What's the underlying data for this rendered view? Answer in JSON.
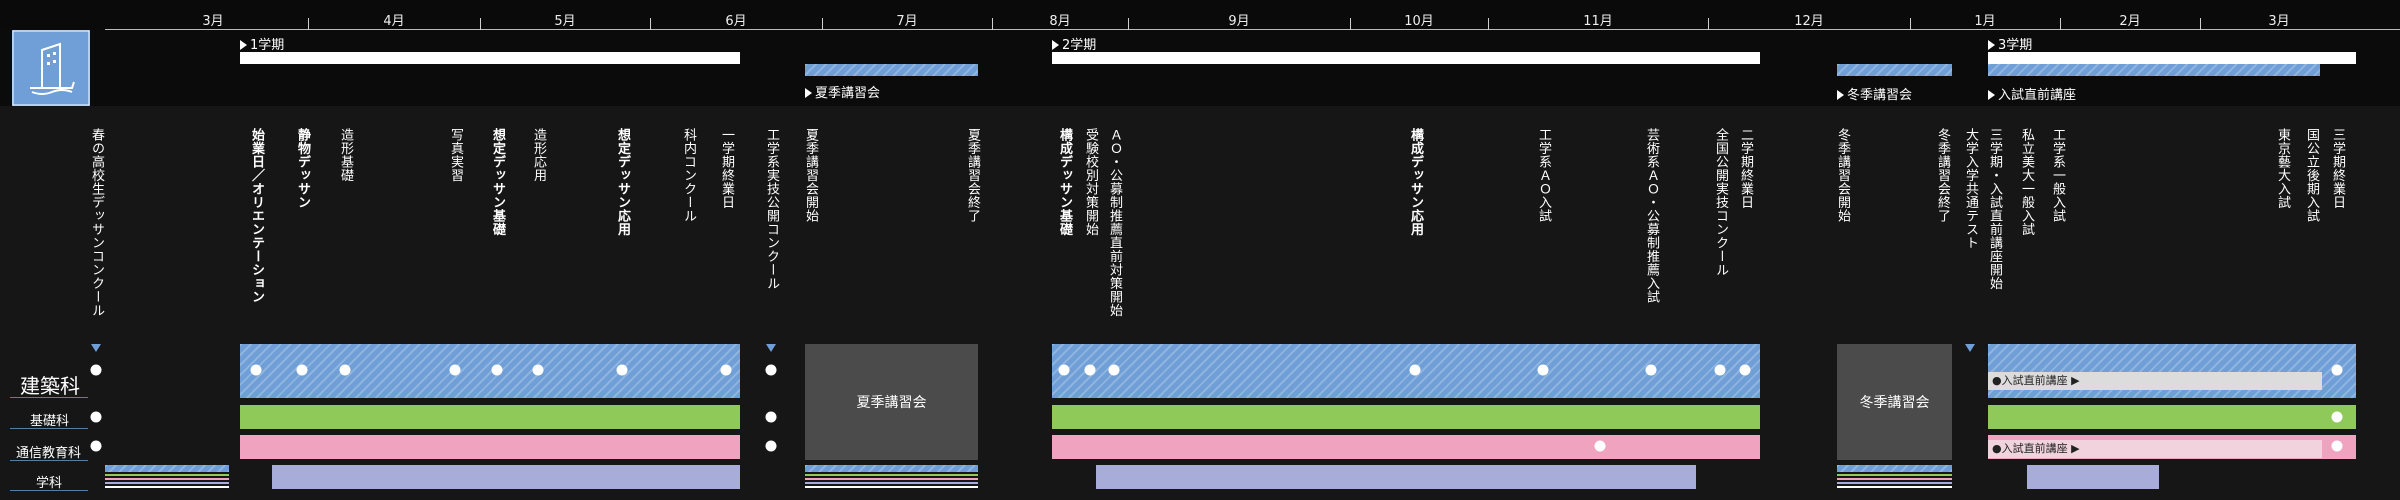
{
  "months": [
    "3月",
    "4月",
    "5月",
    "6月",
    "7月",
    "8月",
    "9月",
    "10月",
    "11月",
    "12月",
    "1月",
    "2月",
    "3月"
  ],
  "terms": {
    "term1": "1学期",
    "term2": "2学期",
    "term3": "3学期",
    "summer": "夏季講習会",
    "winter": "冬季講習会",
    "exam_prep": "入試直前講座"
  },
  "events": [
    {
      "label": "春の高校生デッサンコンクール",
      "bold": false
    },
    {
      "label": "始業日／オリエンテーション",
      "bold": true
    },
    {
      "label": "静物デッサン",
      "bold": true
    },
    {
      "label": "造形基礎",
      "bold": false
    },
    {
      "label": "写真実習",
      "bold": false
    },
    {
      "label": "想定デッサン基礎",
      "bold": true
    },
    {
      "label": "造形応用",
      "bold": false
    },
    {
      "label": "想定デッサン応用",
      "bold": true
    },
    {
      "label": "科内コンクール",
      "bold": false
    },
    {
      "label": "一学期終業日",
      "bold": false
    },
    {
      "label": "工学系実技公開コンクール",
      "bold": false
    },
    {
      "label": "夏季講習会開始",
      "bold": false
    },
    {
      "label": "夏季講習会終了",
      "bold": false
    },
    {
      "label": "構成デッサン基礎",
      "bold": true
    },
    {
      "label": "受験校別対策開始",
      "bold": false
    },
    {
      "label": "ＡＯ・公募制推薦直前対策開始",
      "bold": false
    },
    {
      "label": "構成デッサン応用",
      "bold": true
    },
    {
      "label": "工学系ＡＯ入試",
      "bold": false
    },
    {
      "label": "芸術系ＡＯ・公募制推薦入試",
      "bold": false
    },
    {
      "label": "全国公開実技コンクール",
      "bold": false
    },
    {
      "label": "二学期終業日",
      "bold": false
    },
    {
      "label": "冬季講習会開始",
      "bold": false
    },
    {
      "label": "冬季講習会終了",
      "bold": false
    },
    {
      "label": "大学入学共通テスト",
      "bold": false
    },
    {
      "label": "三学期・入試直前講座開始",
      "bold": false
    },
    {
      "label": "私立美大一般入試",
      "bold": false
    },
    {
      "label": "工学系一般入試",
      "bold": false
    },
    {
      "label": "東京藝大入試",
      "bold": false
    },
    {
      "label": "国公立後期入試",
      "bold": false
    },
    {
      "label": "三学期終業日",
      "bold": false
    }
  ],
  "rows": {
    "architecture": "建築科",
    "basic": "基礎科",
    "distance": "通信教育科",
    "academic": "学科"
  },
  "session_blocks": {
    "summer": "夏季講習会",
    "winter": "冬季講習会"
  },
  "prep_pills": {
    "architecture": "●入試直前講座 ▶",
    "distance": "●入試直前講座 ▶"
  },
  "colors": {
    "accent_blue": "#6f9fd6",
    "basic_green": "#8fc95a",
    "distance_pink": "#f0a3bf",
    "academic_lavender": "#a7acd8",
    "session_grey": "#4b4b4b"
  },
  "icons": {
    "logo": "building-logo-icon"
  }
}
